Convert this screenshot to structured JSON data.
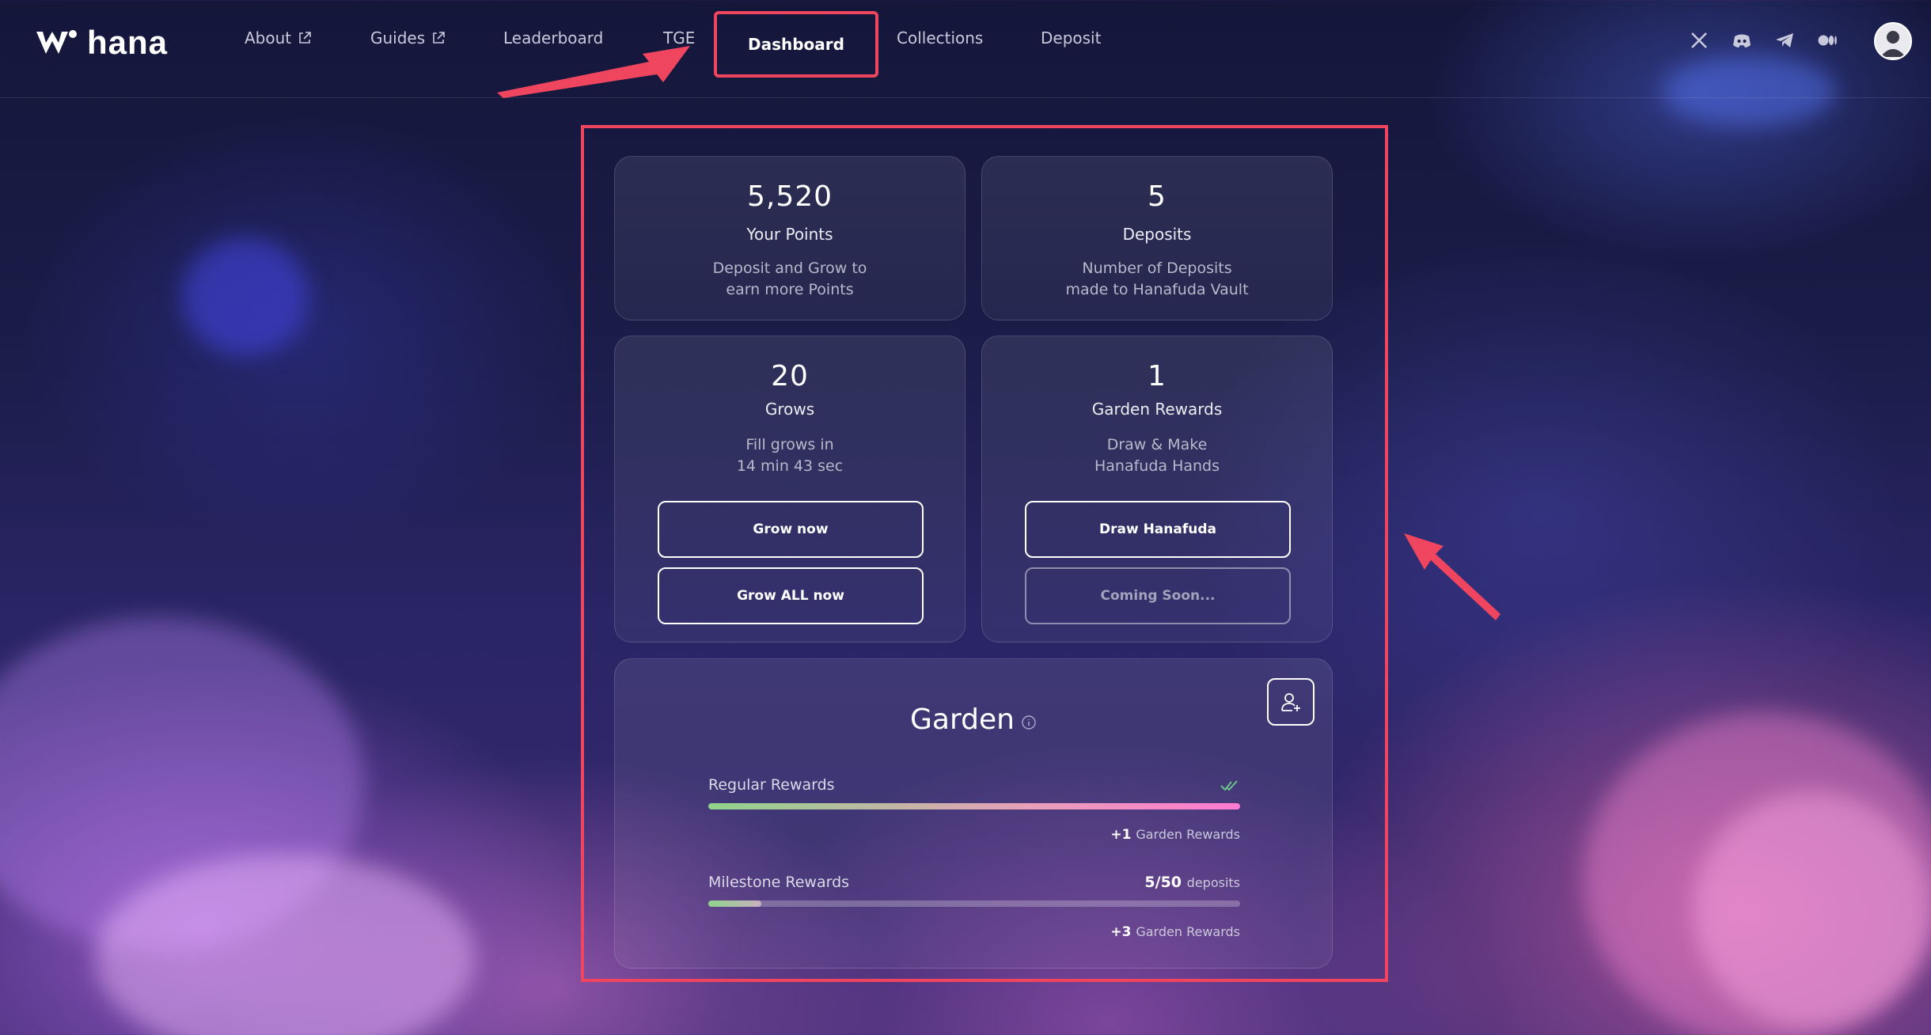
{
  "brand": {
    "name": "hana"
  },
  "nav": {
    "items": [
      {
        "label": "About",
        "external": true
      },
      {
        "label": "Guides",
        "external": true
      },
      {
        "label": "Leaderboard",
        "external": false
      },
      {
        "label": "TGE",
        "external": false
      },
      {
        "label": "Dashboard",
        "active": true
      },
      {
        "label": "Collections",
        "external": false
      },
      {
        "label": "Deposit",
        "external": false
      }
    ]
  },
  "socials": [
    "x-icon",
    "discord-icon",
    "telegram-icon",
    "medium-icon"
  ],
  "cards": {
    "points": {
      "value": "5,520",
      "label": "Your Points",
      "desc_line1": "Deposit and Grow to",
      "desc_line2": "earn more Points"
    },
    "deposits": {
      "value": "5",
      "label": "Deposits",
      "desc_line1": "Number of Deposits",
      "desc_line2": "made to Hanafuda Vault"
    },
    "grows": {
      "value": "20",
      "label": "Grows",
      "desc_line1": "Fill grows in",
      "desc_line2": "14 min 43 sec",
      "btn_grow": "Grow now",
      "btn_grow_all": "Grow ALL now"
    },
    "garden_rewards": {
      "value": "1",
      "label": "Garden Rewards",
      "desc_line1": "Draw & Make",
      "desc_line2": "Hanafuda Hands",
      "btn_draw": "Draw Hanafuda",
      "btn_coming": "Coming Soon..."
    }
  },
  "garden": {
    "title": "Garden",
    "regular": {
      "label": "Regular Rewards",
      "progress": 1.0,
      "reward_count": "+1",
      "reward_unit": "Garden Rewards"
    },
    "milestone": {
      "label": "Milestone Rewards",
      "progress_text": "5/50",
      "progress_unit": "deposits",
      "progress": 0.1,
      "reward_count": "+3",
      "reward_unit": "Garden Rewards"
    }
  },
  "colors": {
    "annotation": "#f0455e",
    "accent_pink": "#ff7ad0",
    "accent_green": "#8fd48a"
  }
}
